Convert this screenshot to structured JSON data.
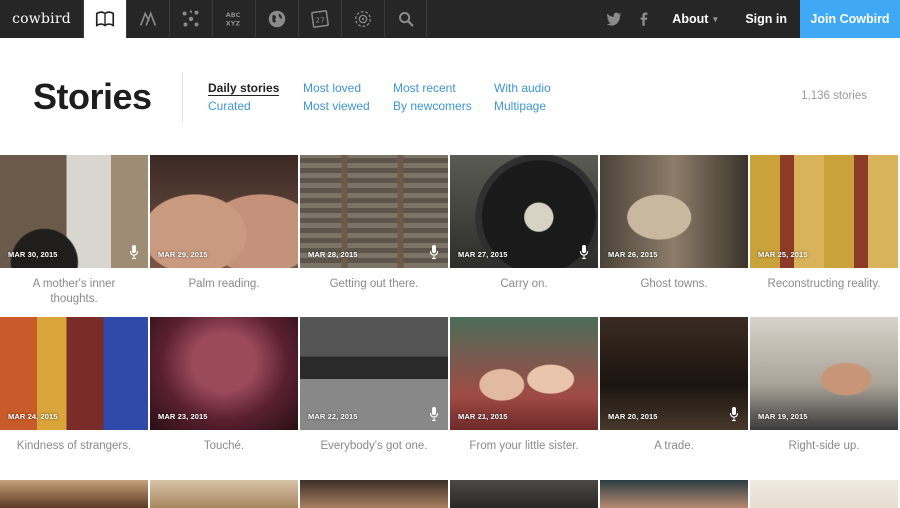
{
  "nav": {
    "logo": "cowbird",
    "icons": [
      {
        "name": "book-icon",
        "active": true
      },
      {
        "name": "people-icon",
        "active": false
      },
      {
        "name": "molecule-icon",
        "active": false
      },
      {
        "name": "alphabet-icon",
        "active": false
      },
      {
        "name": "globe-icon",
        "active": false
      },
      {
        "name": "calendar-icon",
        "active": false
      },
      {
        "name": "spiral-icon",
        "active": false
      },
      {
        "name": "search-icon",
        "active": false
      }
    ],
    "about": "About",
    "signin": "Sign in",
    "join": "Join Cowbird",
    "accent": "#3fa9f5",
    "bar_color": "#262626"
  },
  "header": {
    "title": "Stories",
    "filters": {
      "daily": "Daily stories",
      "curated": "Curated",
      "most_loved": "Most loved",
      "most_viewed": "Most viewed",
      "most_recent": "Most recent",
      "by_newcomers": "By newcomers",
      "with_audio": "With audio",
      "multipage": "Multipage"
    },
    "selected": "Daily stories",
    "count": "1,136 stories",
    "link_color": "#3d95d8"
  },
  "stories": [
    {
      "date": "MAR 30, 2015",
      "caption": "A mother's inner thoughts.",
      "audio": true
    },
    {
      "date": "MAR 29, 2015",
      "caption": "Palm reading.",
      "audio": false
    },
    {
      "date": "MAR 28, 2015",
      "caption": "Getting out there.",
      "audio": true
    },
    {
      "date": "MAR 27, 2015",
      "caption": "Carry on.",
      "audio": true
    },
    {
      "date": "MAR 26, 2015",
      "caption": "Ghost towns.",
      "audio": false
    },
    {
      "date": "MAR 25, 2015",
      "caption": "Reconstructing reality.",
      "audio": false
    },
    {
      "date": "MAR 24, 2015",
      "caption": "Kindness of strangers.",
      "audio": false
    },
    {
      "date": "MAR 23, 2015",
      "caption": "Touché.",
      "audio": false
    },
    {
      "date": "MAR 22, 2015",
      "caption": "Everybody's got one.",
      "audio": true
    },
    {
      "date": "MAR 21, 2015",
      "caption": "From your little sister.",
      "audio": false
    },
    {
      "date": "MAR 20, 2015",
      "caption": "A trade.",
      "audio": true
    },
    {
      "date": "MAR 19, 2015",
      "caption": "Right-side up.",
      "audio": false
    }
  ]
}
